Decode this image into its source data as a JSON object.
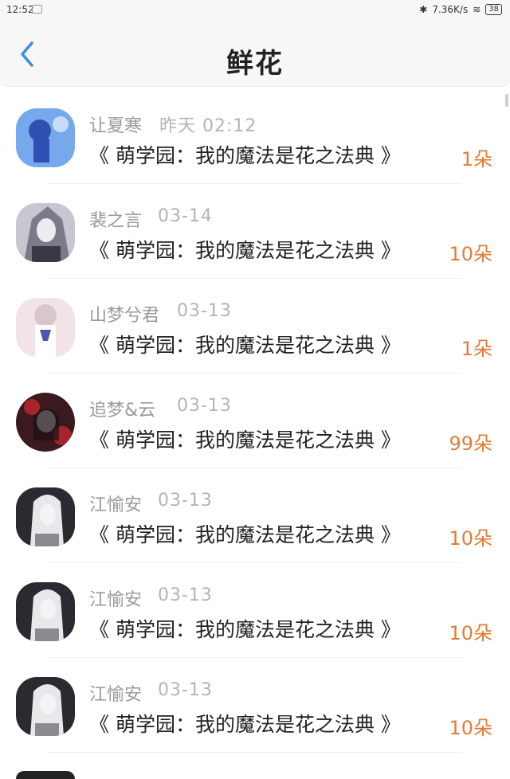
{
  "status": {
    "time": "12:52",
    "network_speed": "7.36K/s",
    "battery": "38"
  },
  "header": {
    "title": "鲜花"
  },
  "items": [
    {
      "user": "让夏寒",
      "time": "昨天 02:12",
      "title": "《 萌学园：我的魔法是花之法典 》",
      "amount": "1朵",
      "avatar_colors": [
        "#5a86e8",
        "#9ad2f2",
        "#2f4fb3"
      ]
    },
    {
      "user": "裴之言",
      "time": "03-14",
      "title": "《 萌学园：我的魔法是花之法典 》",
      "amount": "10朵",
      "avatar_colors": [
        "#c8c6d0",
        "#7b7a8a",
        "#3a3844"
      ]
    },
    {
      "user": "山梦兮君",
      "time": "03-13",
      "title": "《 萌学园：我的魔法是花之法典 》",
      "amount": "1朵",
      "avatar_colors": [
        "#f2e4e6",
        "#d9c6cc",
        "#4a5aa8"
      ]
    },
    {
      "user": "追梦&云",
      "time": "03-13",
      "title": "《 萌学园：我的魔法是花之法典 》",
      "amount": "99朵",
      "avatar_colors": [
        "#3a1a1e",
        "#a8242c",
        "#e9e2e0"
      ]
    },
    {
      "user": "江愉安",
      "time": "03-13",
      "title": "《 萌学园：我的魔法是花之法典 》",
      "amount": "10朵",
      "avatar_colors": [
        "#2a2a30",
        "#8a8a92",
        "#e8e8ea"
      ]
    },
    {
      "user": "江愉安",
      "time": "03-13",
      "title": "《 萌学园：我的魔法是花之法典 》",
      "amount": "10朵",
      "avatar_colors": [
        "#2a2a30",
        "#8a8a92",
        "#e8e8ea"
      ]
    },
    {
      "user": "江愉安",
      "time": "03-13",
      "title": "《 萌学园：我的魔法是花之法典 》",
      "amount": "10朵",
      "avatar_colors": [
        "#2a2a30",
        "#8a8a92",
        "#e8e8ea"
      ]
    }
  ],
  "colors": {
    "accent_back": "#3b8ee8",
    "amount": "#e07e3a"
  }
}
